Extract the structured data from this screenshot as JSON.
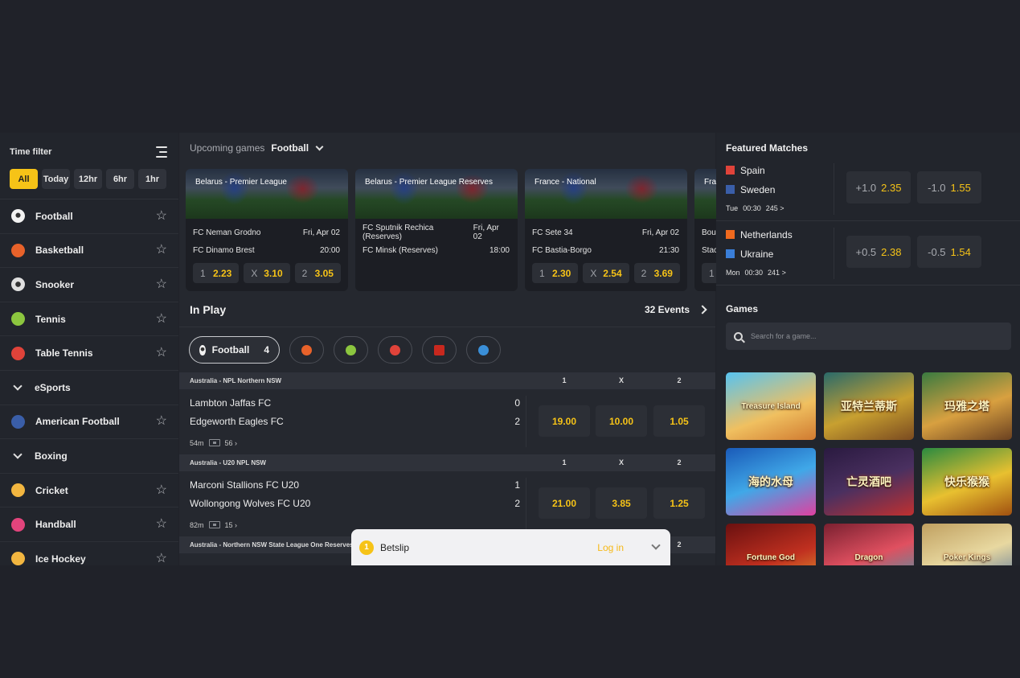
{
  "sidebar": {
    "title": "Time filter",
    "filters": [
      "All",
      "Today",
      "12hr",
      "6hr",
      "1hr"
    ],
    "sports": [
      {
        "label": "Football",
        "icon": "football-icon",
        "color": "#f2f2f2",
        "star": true
      },
      {
        "label": "Basketball",
        "icon": "basketball-icon",
        "color": "#e8622a",
        "star": true
      },
      {
        "label": "Snooker",
        "icon": "snooker-icon",
        "color": "#e0e0e0",
        "star": true
      },
      {
        "label": "Tennis",
        "icon": "tennis-icon",
        "color": "#8cc63f",
        "star": true
      },
      {
        "label": "Table Tennis",
        "icon": "table-tennis-icon",
        "color": "#e0433a",
        "star": true
      },
      {
        "label": "eSports",
        "icon": "chevron-down-icon",
        "star": false
      },
      {
        "label": "American Football",
        "icon": "nfl-icon",
        "color": "#3a5ea8",
        "star": true
      },
      {
        "label": "Boxing",
        "icon": "chevron-down-icon",
        "star": false
      },
      {
        "label": "Cricket",
        "icon": "cricket-icon",
        "color": "#f2b640",
        "star": true
      },
      {
        "label": "Handball",
        "icon": "handball-icon",
        "color": "#e2447c",
        "star": true
      },
      {
        "label": "Ice Hockey",
        "icon": "ice-hockey-icon",
        "color": "#f2b640",
        "star": true
      }
    ]
  },
  "upcoming": {
    "label": "Upcoming games",
    "sport": "Football",
    "cards": [
      {
        "league": "Belarus - Premier League",
        "home": "FC Neman Grodno",
        "date": "Fri, Apr 02",
        "away": "FC Dinamo Brest",
        "time": "20:00",
        "odds": [
          {
            "l": "1",
            "v": "2.23"
          },
          {
            "l": "X",
            "v": "3.10"
          },
          {
            "l": "2",
            "v": "3.05"
          }
        ]
      },
      {
        "league": "Belarus - Premier League Reserves",
        "home": "FC Sputnik Rechica (Reserves)",
        "date": "Fri, Apr 02",
        "away": "FC Minsk (Reserves)",
        "time": "18:00",
        "odds": []
      },
      {
        "league": "France - National",
        "home": "FC Sete 34",
        "date": "Fri, Apr 02",
        "away": "FC Bastia-Borgo",
        "time": "21:30",
        "odds": [
          {
            "l": "1",
            "v": "2.30"
          },
          {
            "l": "X",
            "v": "2.54"
          },
          {
            "l": "2",
            "v": "3.69"
          }
        ]
      },
      {
        "league": "Fra",
        "home": "Bou",
        "date": "",
        "away": "Stac",
        "time": "",
        "odds": [
          {
            "l": "1",
            "v": ""
          }
        ]
      }
    ]
  },
  "inplay": {
    "title": "In Play",
    "events_label": "32 Events",
    "active_filter": {
      "label": "Football",
      "count": "4"
    },
    "filter_icons": [
      {
        "icon": "basketball-icon",
        "color": "#e8622a"
      },
      {
        "icon": "tennis-icon",
        "color": "#8cc63f"
      },
      {
        "icon": "table-tennis-icon",
        "color": "#e0433a"
      },
      {
        "icon": "dota-icon",
        "color": "#c8281e"
      },
      {
        "icon": "volleyball-icon",
        "color": "#3a8fd8"
      }
    ],
    "col_headers": [
      "1",
      "X",
      "2"
    ],
    "groups": [
      {
        "league": "Australia - NPL Northern NSW",
        "home": "Lambton Jaffas FC",
        "home_score": "0",
        "away": "Edgeworth Eagles FC",
        "away_score": "2",
        "minute": "54m",
        "markets": "56 ›",
        "odds": [
          "19.00",
          "10.00",
          "1.05"
        ]
      },
      {
        "league": "Australia - U20 NPL NSW",
        "home": "Marconi Stallions FC U20",
        "home_score": "1",
        "away": "Wollongong Wolves FC U20",
        "away_score": "2",
        "minute": "82m",
        "markets": "15 ›",
        "odds": [
          "21.00",
          "3.85",
          "1.25"
        ]
      },
      {
        "league": "Australia - Northern NSW State League One Reserves",
        "col2": "2"
      }
    ]
  },
  "featured": {
    "title": "Featured Matches",
    "matches": [
      {
        "home": "Spain",
        "home_color": "#e0433a",
        "away": "Sweden",
        "away_color": "#3a5ea8",
        "day": "Tue",
        "time": "00:30",
        "markets": "245 >",
        "h1": "+1.0",
        "v1": "2.35",
        "h2": "-1.0",
        "v2": "1.55"
      },
      {
        "home": "Netherlands",
        "home_color": "#f06a1e",
        "away": "Ukraine",
        "away_color": "#3a7ed8",
        "day": "Mon",
        "time": "00:30",
        "markets": "241 >",
        "h1": "+0.5",
        "v1": "2.38",
        "h2": "-0.5",
        "v2": "1.54"
      }
    ]
  },
  "games": {
    "title": "Games",
    "search_placeholder": "Search for a game...",
    "tiles": [
      "Treasure Island",
      "亚特兰蒂斯",
      "玛雅之塔",
      "海的水母",
      "亡灵酒吧",
      "快乐猴猴",
      "Fortune God",
      "Dragon",
      "Poker Kings"
    ]
  },
  "betslip": {
    "count": "1",
    "title": "Betslip",
    "login": "Log in"
  },
  "colors": {
    "accent": "#f6c317",
    "bg": "#202229",
    "panel": "#25282f"
  }
}
